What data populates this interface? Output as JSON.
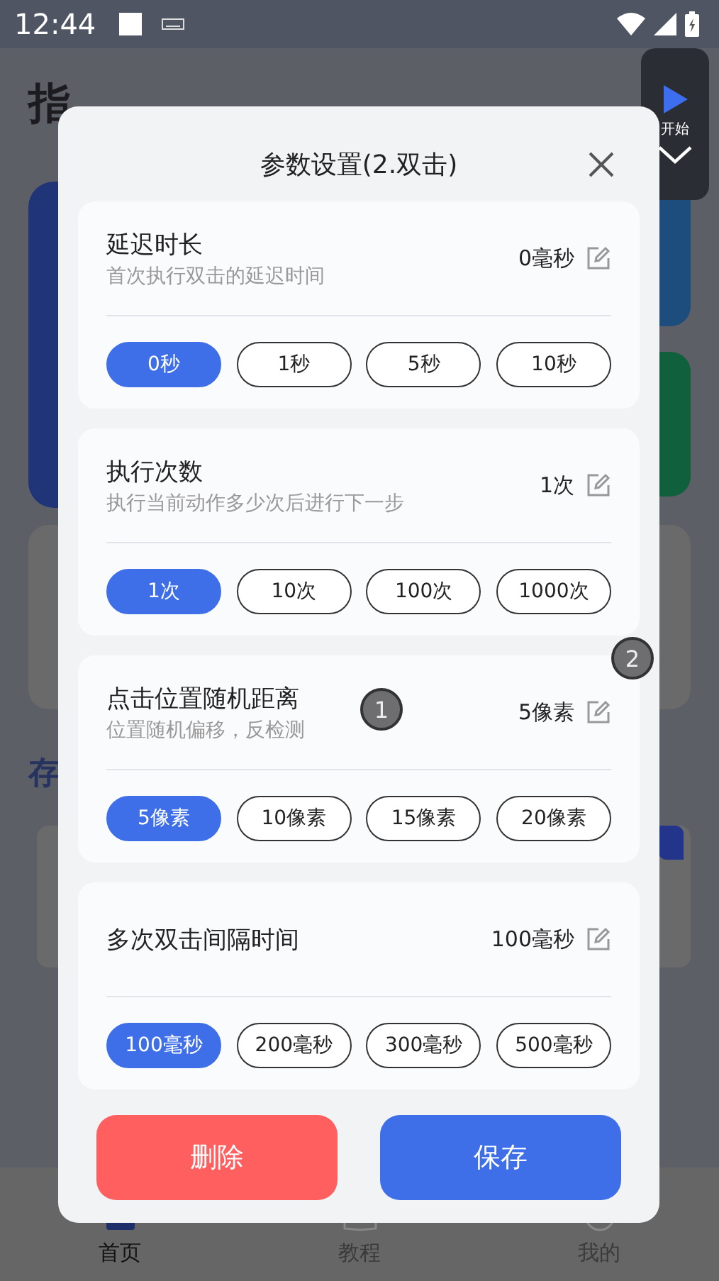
{
  "status_bar": {
    "time": "12:44"
  },
  "page": {
    "title": "指",
    "section_title": "存"
  },
  "floating_control": {
    "label": "开始"
  },
  "dialog": {
    "title": "参数设置(2.双击)",
    "sections": [
      {
        "title": "延迟时长",
        "subtitle": "首次执行双击的延迟时间",
        "value": "0毫秒",
        "options": [
          {
            "label": "0秒",
            "selected": true
          },
          {
            "label": "1秒",
            "selected": false
          },
          {
            "label": "5秒",
            "selected": false
          },
          {
            "label": "10秒",
            "selected": false
          }
        ]
      },
      {
        "title": "执行次数",
        "subtitle": "执行当前动作多少次后进行下一步",
        "value": "1次",
        "options": [
          {
            "label": "1次",
            "selected": true
          },
          {
            "label": "10次",
            "selected": false
          },
          {
            "label": "100次",
            "selected": false
          },
          {
            "label": "1000次",
            "selected": false
          }
        ]
      },
      {
        "title": "点击位置随机距离",
        "subtitle": "位置随机偏移，反检测",
        "value": "5像素",
        "options": [
          {
            "label": "5像素",
            "selected": true
          },
          {
            "label": "10像素",
            "selected": false
          },
          {
            "label": "15像素",
            "selected": false
          },
          {
            "label": "20像素",
            "selected": false
          }
        ]
      },
      {
        "title": "多次双击间隔时间",
        "value": "100毫秒",
        "options": [
          {
            "label": "100毫秒",
            "selected": true
          },
          {
            "label": "200毫秒",
            "selected": false
          },
          {
            "label": "300毫秒",
            "selected": false
          },
          {
            "label": "500毫秒",
            "selected": false
          }
        ]
      }
    ],
    "buttons": [
      {
        "label": "删除",
        "kind": "danger"
      },
      {
        "label": "保存",
        "kind": "primary"
      }
    ]
  },
  "markers": [
    "1",
    "2"
  ],
  "bottom_nav": [
    {
      "label": "首页",
      "selected": true
    },
    {
      "label": "教程",
      "selected": false
    },
    {
      "label": "我的",
      "selected": false
    }
  ]
}
